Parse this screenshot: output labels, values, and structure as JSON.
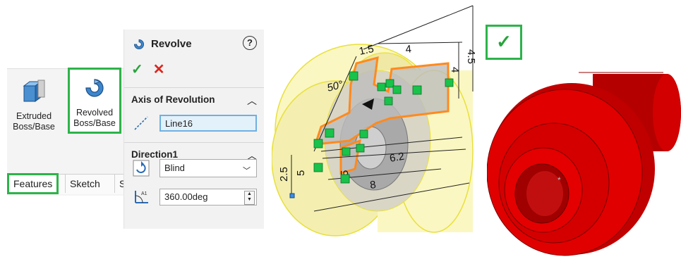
{
  "ribbon": {
    "tools": [
      {
        "line1": "Extruded",
        "line2": "Boss/Base"
      },
      {
        "line1": "Revolved",
        "line2": "Boss/Base"
      }
    ],
    "tabs": [
      "Features",
      "Sketch",
      "S"
    ]
  },
  "pm": {
    "title": "Revolve",
    "help": "?",
    "ok": "✓",
    "cancel": "✕",
    "axis": {
      "title": "Axis of Revolution",
      "value": "Line16"
    },
    "direction": {
      "title": "Direction1",
      "type": "Blind",
      "angle": "360.00deg"
    }
  },
  "sketch_dims": [
    "1.5",
    "4",
    "4.5",
    "50°",
    "4",
    "6.2",
    "8",
    "2.5",
    "5",
    "5"
  ],
  "confirm": {
    "symbol": "✓"
  },
  "colors": {
    "accent_green": "#2db34a",
    "part_red": "#e00000",
    "preview_yellow": "#fbf7c2",
    "sketch_orange": "#ff8a1e"
  }
}
